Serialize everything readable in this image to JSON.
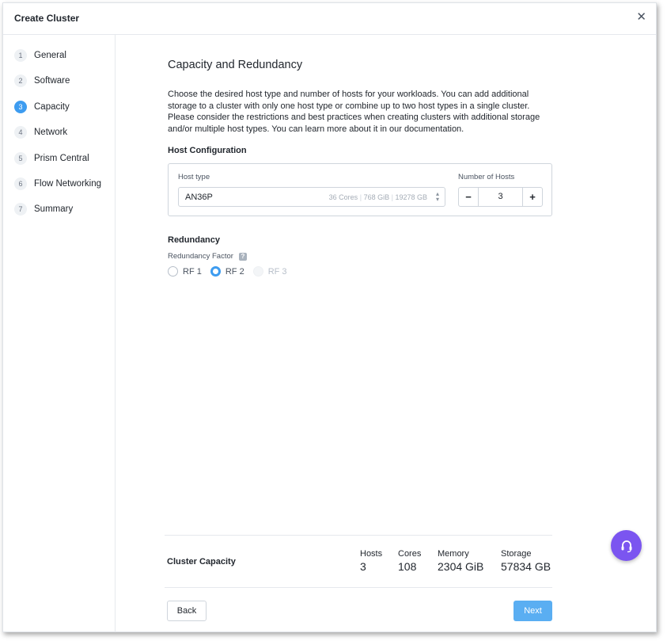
{
  "dialog": {
    "title": "Create Cluster",
    "close_icon": "close-icon"
  },
  "steps": [
    {
      "number": "1",
      "label": "General"
    },
    {
      "number": "2",
      "label": "Software"
    },
    {
      "number": "3",
      "label": "Capacity",
      "active": true
    },
    {
      "number": "4",
      "label": "Network"
    },
    {
      "number": "5",
      "label": "Prism Central"
    },
    {
      "number": "6",
      "label": "Flow Networking"
    },
    {
      "number": "7",
      "label": "Summary"
    }
  ],
  "main": {
    "title": "Capacity and Redundancy",
    "description": "Choose the desired host type and number of hosts for your workloads. You can add additional storage to a cluster with only one host type or combine up to two host types in a single cluster. Please consider the restrictions and best practices when creating clusters with additional storage and/or multiple host types. You can learn more about it in our documentation.",
    "host_config": {
      "heading": "Host Configuration",
      "host_type_label": "Host type",
      "host_type_value": "AN36P",
      "specs": {
        "cores": "36 Cores",
        "memory": "768 GiB",
        "storage": "19278 GB"
      },
      "num_hosts_label": "Number of Hosts",
      "num_hosts_value": "3",
      "minus": "−",
      "plus": "+"
    },
    "redundancy": {
      "heading": "Redundancy",
      "factor_label": "Redundancy Factor",
      "help": "?",
      "options": [
        {
          "label": "RF 1",
          "checked": false,
          "disabled": false
        },
        {
          "label": "RF 2",
          "checked": true,
          "disabled": false
        },
        {
          "label": "RF 3",
          "checked": false,
          "disabled": true
        }
      ]
    }
  },
  "capacity": {
    "title": "Cluster Capacity",
    "stats": [
      {
        "label": "Hosts",
        "value": "3"
      },
      {
        "label": "Cores",
        "value": "108"
      },
      {
        "label": "Memory",
        "value": "2304 GiB"
      },
      {
        "label": "Storage",
        "value": "57834 GB"
      }
    ]
  },
  "footer": {
    "back_label": "Back",
    "next_label": "Next"
  },
  "colors": {
    "accent": "#3d9cf0",
    "next_button": "#5aaef2",
    "fab": "#7b55f0"
  },
  "fab": {
    "icon": "support-headset-icon"
  }
}
